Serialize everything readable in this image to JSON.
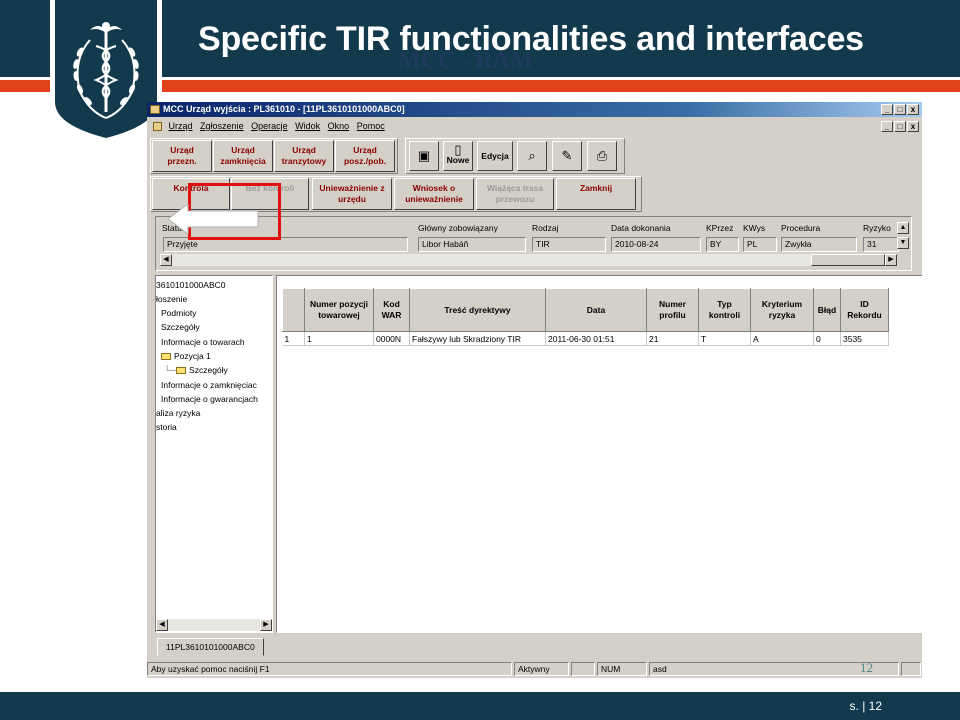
{
  "slide": {
    "title": "Specific TIR functionalities and interfaces",
    "ghost_text": "MCC - RAM",
    "page_label": "s. | 12",
    "watermark_number": "12",
    "colors": {
      "header": "#123a4c",
      "accent": "#e2431a",
      "annotation": "#e01010"
    }
  },
  "window": {
    "title": "MCC Urząd wyjścia : PL361010 - [11PL3610101000ABC0]",
    "controls": [
      "_",
      "□",
      "x"
    ]
  },
  "menu": [
    "Urząd",
    "Zgłoszenie",
    "Operacje",
    "Widok",
    "Okno",
    "Pomoc"
  ],
  "toolbar1": {
    "buttons": [
      {
        "label1": "Urząd",
        "label2": "przezn."
      },
      {
        "label1": "Urząd",
        "label2": "zamknięcia"
      },
      {
        "label1": "Urząd",
        "label2": "tranzytowy"
      },
      {
        "label1": "Urząd",
        "label2": "posz./pob."
      }
    ],
    "icons": [
      {
        "icon": "monitor-icon",
        "label": ""
      },
      {
        "icon": "new-document-icon",
        "label": "Nowe"
      },
      {
        "icon": "edit-icon",
        "label": "Edycja"
      },
      {
        "icon": "binoculars-icon",
        "label": ""
      },
      {
        "icon": "stamp-icon",
        "label": ""
      },
      {
        "icon": "printer-icon",
        "label": ""
      }
    ]
  },
  "toolbar2": {
    "buttons": [
      {
        "label1": "Kontrola",
        "label2": "",
        "state": "active"
      },
      {
        "label1": "Bez kontroli",
        "label2": "",
        "state": "dim"
      },
      {
        "label1": "Unieważnienie z",
        "label2": "urzędu",
        "state": "active"
      },
      {
        "label1": "Wniosek o",
        "label2": "unieważnienie",
        "state": "active"
      },
      {
        "label1": "Wiążąca trasa",
        "label2": "przewozu",
        "state": "dim"
      },
      {
        "label1": "Zamknij",
        "label2": "",
        "state": "active"
      }
    ]
  },
  "header_fields": {
    "labels": [
      "Status",
      "Główny zobowiązany",
      "Rodzaj",
      "Data dokonania",
      "KPrzez",
      "KWys",
      "Procedura",
      "Ryzyko"
    ],
    "values": [
      "Przyjęte",
      "Libor Habáň",
      "TIR",
      "2010-08-24",
      "BY",
      "PL",
      "Zwykła",
      "31"
    ]
  },
  "tree": [
    {
      "label": "3610101000ABC0",
      "level": 0,
      "folder": false
    },
    {
      "label": "łoszenie",
      "level": 0,
      "folder": false
    },
    {
      "label": "Podmioty",
      "level": 1,
      "folder": false
    },
    {
      "label": "Szczegóły",
      "level": 1,
      "folder": false
    },
    {
      "label": "Informacje o towarach",
      "level": 1,
      "folder": false
    },
    {
      "label": "Pozycja 1",
      "level": 1,
      "folder": true
    },
    {
      "label": "Szczegóły",
      "level": 2,
      "folder": true
    },
    {
      "label": "Informacje o zamknięciac",
      "level": 1,
      "folder": false
    },
    {
      "label": "Informacje o gwarancjach",
      "level": 1,
      "folder": false
    },
    {
      "label": "aliza ryzyka",
      "level": 0,
      "folder": false
    },
    {
      "label": "storia",
      "level": 0,
      "folder": false
    }
  ],
  "grid": {
    "columns": [
      "",
      "Numer pozycji towarowej",
      "Kod WAR",
      "Treść dyrektywy",
      "Data",
      "Numer profilu",
      "Typ kontroli",
      "Kryterium ryzyka",
      "Błąd",
      "ID Rekordu"
    ],
    "rows": [
      [
        "1",
        "1",
        "0000N",
        "Fałszywy lub Skradziony TIR",
        "2011-06-30 01:51",
        "21",
        "T",
        "A",
        "0",
        "3535"
      ]
    ]
  },
  "tab": "11PL3610101000ABC0",
  "status": {
    "help": "Aby uzyskać pomoc naciśnij F1",
    "state": "Aktywny",
    "num": "NUM",
    "user": "asd"
  }
}
